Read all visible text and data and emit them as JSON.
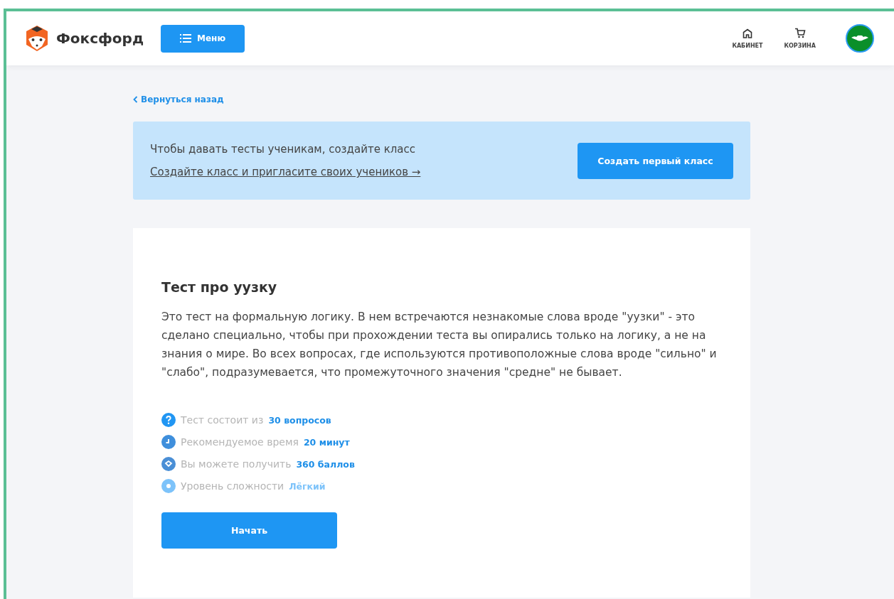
{
  "header": {
    "logo": "Фоксфорд",
    "menu_button": "Меню",
    "nav": [
      {
        "kind": "home",
        "label": "КАБИНЕТ"
      },
      {
        "kind": "cart",
        "label": "КОРЗИНА"
      }
    ]
  },
  "back_link": "Вернуться назад",
  "banner": {
    "text": "Чтобы давать тесты ученикам, создайте класс",
    "link": "Создайте класс и пригласите своих учеников →",
    "button": "Создать первый класс"
  },
  "test": {
    "title": "Тест про уузку",
    "description": "Это тест на формальную логику. В нем встречаются незнакомые слова вроде \"уузки\" - это сделано специально, чтобы при прохождении теста вы опирались только на логику, а не на знания о мире. Во всех вопросах, где используются противоположные слова вроде \"сильно\" и \"слабо\", подразумевается, что промежуточного значения \"средне\" не бывает.",
    "facts": [
      {
        "kind": "question",
        "color": "#2196f3",
        "label": "Тест состоит из",
        "value": "30 вопросов"
      },
      {
        "kind": "clock",
        "color": "#3f8fdc",
        "label": "Рекомендуемое время",
        "value": "20 минут"
      },
      {
        "kind": "diamond",
        "color": "#4a8fd6",
        "label": "Вы можете получить",
        "value": "360 баллов"
      },
      {
        "kind": "dot",
        "color": "#7dc3fa",
        "label": "Уровень сложности",
        "value": "Лёгкий"
      }
    ],
    "start_button": "Начать"
  }
}
